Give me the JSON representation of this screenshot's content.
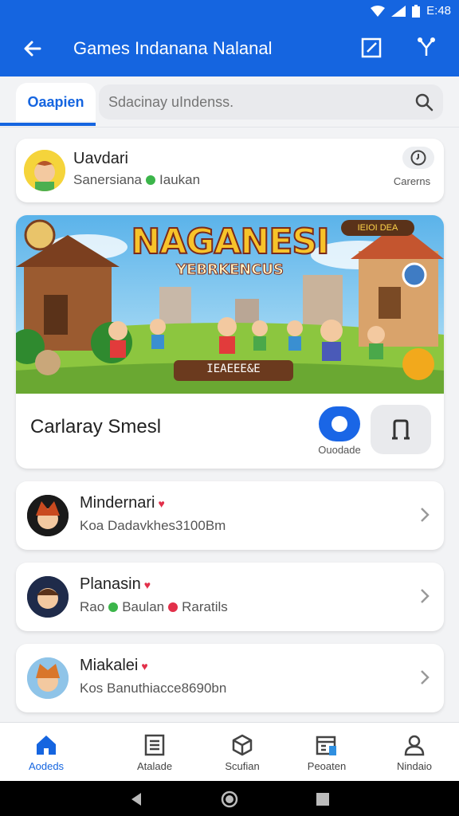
{
  "status_bar": {
    "time": "E:48"
  },
  "app_bar": {
    "title": "Games Indanana Nalanal"
  },
  "tabs": {
    "active_label": "Oaapien"
  },
  "search": {
    "placeholder": "Sdacinay uIndenss."
  },
  "profile": {
    "name": "Uavdari",
    "status_text": "Sanersiana",
    "status_extra": "Iaukan",
    "action_label": "Carerns"
  },
  "featured": {
    "banner_title": "NAGANESI",
    "banner_subtitle": "YEBRKENCUS",
    "banner_tag": "IEIOI DEA",
    "banner_score": "IEAEEE&E",
    "title": "Carlaray Smesl",
    "play_label": "Ouodade"
  },
  "friends": [
    {
      "name": "Mindernari",
      "sub": "Koa Dadavkhes3100Bm"
    },
    {
      "name": "Planasin",
      "sub_a": "Rao",
      "sub_b": "Baulan",
      "sub_c": "Raratils"
    },
    {
      "name": "Miakalei",
      "sub": "Kos Banuthiacce8690bn"
    }
  ],
  "bottom_nav": [
    "Aodeds",
    "Atalade",
    "Scufian",
    "Peoaten",
    "Nindaio"
  ],
  "colors": {
    "accent": "#1565e0",
    "heart": "#e2304a",
    "online": "#3bb54a"
  }
}
